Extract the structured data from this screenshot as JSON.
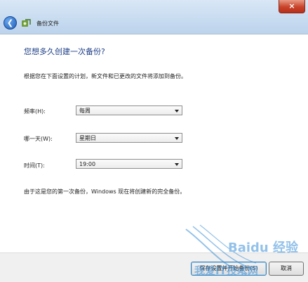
{
  "window": {
    "title": "备份文件",
    "close_glyph": "×"
  },
  "icons": {
    "back": "back-arrow-icon",
    "app": "backup-icon",
    "dropdown": "chevron-down-icon"
  },
  "page": {
    "heading": "您想多久创建一次备份?",
    "description": "根据您在下面设置的计划，新文件和已更改的文件将添加到备份。",
    "note": "由于这是您的第一次备份，Windows 现在将创建新的完全备份。"
  },
  "schedule": {
    "frequency": {
      "label": "频率(H):",
      "value": "每周"
    },
    "day": {
      "label": "哪一天(W):",
      "value": "星期日"
    },
    "time": {
      "label": "时间(T):",
      "value": "19:00"
    }
  },
  "footer": {
    "primary_label": "保存设置并开始备份(S)",
    "cancel_label": "取消"
  },
  "watermark": {
    "brand": "Baidu 经验",
    "text": "我爱IT技术网"
  },
  "colors": {
    "heading": "#1e3f87",
    "titlebar": "#c7dbf0",
    "close": "#c8432a"
  }
}
